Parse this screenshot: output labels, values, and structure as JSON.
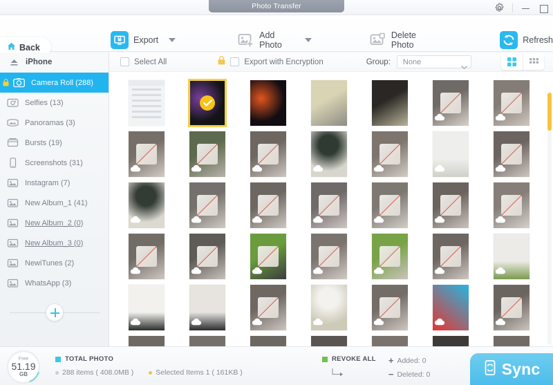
{
  "window": {
    "title": "Photo Transfer",
    "controls": {
      "settings": "gear-icon",
      "minimize": "minimize-icon",
      "maximize": "maximize-icon"
    }
  },
  "toolbar": {
    "back_label": "Back",
    "items": [
      {
        "label": "Export",
        "icon": "export-icon",
        "has_caret": true,
        "accent": true
      },
      {
        "label": "Add Photo",
        "icon": "add-photo-icon",
        "has_caret": true,
        "accent": false
      },
      {
        "label": "Delete Photo",
        "icon": "delete-photo-icon",
        "has_caret": false,
        "accent": false
      },
      {
        "label": "Refresh",
        "icon": "refresh-icon",
        "has_caret": false,
        "accent": true
      }
    ]
  },
  "sidebar": {
    "device": "iPhone",
    "albums": [
      {
        "label": "Camera Roll (288)",
        "active": true,
        "locked": true,
        "underlined": false,
        "icon": "camera-icon"
      },
      {
        "label": "Selfies (13)",
        "active": false,
        "locked": false,
        "underlined": false,
        "icon": "selfie-icon"
      },
      {
        "label": "Panoramas (3)",
        "active": false,
        "locked": false,
        "underlined": false,
        "icon": "panorama-icon"
      },
      {
        "label": "Bursts (19)",
        "active": false,
        "locked": false,
        "underlined": false,
        "icon": "burst-icon"
      },
      {
        "label": "Screenshots (31)",
        "active": false,
        "locked": false,
        "underlined": false,
        "icon": "phone-icon"
      },
      {
        "label": "Instagram (7)",
        "active": false,
        "locked": false,
        "underlined": false,
        "icon": "album-icon"
      },
      {
        "label": "New Album_1 (41)",
        "active": false,
        "locked": false,
        "underlined": false,
        "icon": "album-icon"
      },
      {
        "label": "New Album_2 (0)",
        "active": false,
        "locked": false,
        "underlined": true,
        "icon": "album-icon"
      },
      {
        "label": "New Album_3 (0)",
        "active": false,
        "locked": false,
        "underlined": true,
        "icon": "album-icon"
      },
      {
        "label": "NewiTunes (2)",
        "active": false,
        "locked": false,
        "underlined": false,
        "icon": "album-icon"
      },
      {
        "label": "WhatsApp (3)",
        "active": false,
        "locked": false,
        "underlined": false,
        "icon": "album-icon"
      }
    ],
    "add_album": "add-album-button"
  },
  "content_header": {
    "select_all_label": "Select All",
    "select_all_checked": false,
    "encryption_label": "Export with Encryption",
    "encryption_checked": false,
    "encryption_icon": "lock-icon",
    "group_label": "Group:",
    "group_value": "None",
    "group_options": [
      "None"
    ],
    "view_modes": [
      {
        "name": "large-grid-view",
        "active": true
      },
      {
        "name": "small-grid-view",
        "active": false
      }
    ]
  },
  "grid": {
    "scroll_position": "top",
    "photos": [
      {
        "cloud": false,
        "selected": false,
        "c1": "#f2f3f5",
        "c2": "#e4e6ea",
        "kind": "screenshot"
      },
      {
        "cloud": false,
        "selected": true,
        "c1": "#7a3f9d",
        "c2": "#141418",
        "kind": "wallpaper"
      },
      {
        "cloud": false,
        "selected": false,
        "c1": "#e2541f",
        "c2": "#120d12",
        "kind": "wallpaper"
      },
      {
        "cloud": false,
        "selected": false,
        "c1": "#d8d4b4",
        "c2": "#8e8c84",
        "kind": "glass"
      },
      {
        "cloud": false,
        "selected": false,
        "c1": "#2a2724",
        "c2": "#b9b49a",
        "kind": "glass"
      },
      {
        "cloud": true,
        "selected": false,
        "c1": "#6f6a66",
        "c2": "#d9d2cc",
        "kind": "hand"
      },
      {
        "cloud": true,
        "selected": false,
        "c1": "#847d76",
        "c2": "#cfc7bf",
        "kind": "hand"
      },
      {
        "cloud": true,
        "selected": false,
        "c1": "#766f69",
        "c2": "#d2cbc4",
        "kind": "hand"
      },
      {
        "cloud": true,
        "selected": false,
        "c1": "#5d6a4e",
        "c2": "#b8b2aa",
        "kind": "hand"
      },
      {
        "cloud": true,
        "selected": false,
        "c1": "#6e6761",
        "c2": "#cdc6c0",
        "kind": "hand"
      },
      {
        "cloud": true,
        "selected": false,
        "c1": "#2f3a33",
        "c2": "#d8d6cc",
        "kind": "stand"
      },
      {
        "cloud": true,
        "selected": false,
        "c1": "#7d756e",
        "c2": "#d3ccc6",
        "kind": "hand"
      },
      {
        "cloud": true,
        "selected": false,
        "c1": "#eeeeec",
        "c2": "#cfd1c8",
        "kind": "monitor"
      },
      {
        "cloud": true,
        "selected": false,
        "c1": "#6b6460",
        "c2": "#cec7c1",
        "kind": "hand"
      },
      {
        "cloud": true,
        "selected": false,
        "c1": "#323b34",
        "c2": "#dcd9d0",
        "kind": "stand"
      },
      {
        "cloud": true,
        "selected": false,
        "c1": "#74706b",
        "c2": "#d0cac4",
        "kind": "hand"
      },
      {
        "cloud": true,
        "selected": false,
        "c1": "#6d6762",
        "c2": "#cfc8c2",
        "kind": "hand"
      },
      {
        "cloud": true,
        "selected": false,
        "c1": "#70696a",
        "c2": "#cec6c4",
        "kind": "hand"
      },
      {
        "cloud": true,
        "selected": false,
        "c1": "#7e7872",
        "c2": "#d4cec8",
        "kind": "hand"
      },
      {
        "cloud": true,
        "selected": false,
        "c1": "#6a635e",
        "c2": "#cbc3bd",
        "kind": "hand"
      },
      {
        "cloud": true,
        "selected": false,
        "c1": "#867f79",
        "c2": "#d6d0ca",
        "kind": "hand"
      },
      {
        "cloud": true,
        "selected": false,
        "c1": "#726c67",
        "c2": "#cdc6c1",
        "kind": "hand"
      },
      {
        "cloud": true,
        "selected": false,
        "c1": "#5f5b57",
        "c2": "#c8c1bb",
        "kind": "hand"
      },
      {
        "cloud": true,
        "selected": false,
        "c1": "#6a9c3d",
        "c2": "#3b3b3f",
        "kind": "hand"
      },
      {
        "cloud": true,
        "selected": false,
        "c1": "#7b746e",
        "c2": "#d2cbc5",
        "kind": "hand"
      },
      {
        "cloud": true,
        "selected": false,
        "c1": "#78a347",
        "c2": "#cac3bd",
        "kind": "hand"
      },
      {
        "cloud": true,
        "selected": false,
        "c1": "#6d6661",
        "c2": "#cec7c1",
        "kind": "hand"
      },
      {
        "cloud": true,
        "selected": false,
        "c1": "#ecebe7",
        "c2": "#7b9a4e",
        "kind": "monitor"
      },
      {
        "cloud": true,
        "selected": false,
        "c1": "#f2f1ed",
        "c2": "#2b2f2c",
        "kind": "monitor"
      },
      {
        "cloud": true,
        "selected": false,
        "c1": "#e7e4e0",
        "c2": "#2a2c2e",
        "kind": "monitor"
      },
      {
        "cloud": true,
        "selected": false,
        "c1": "#6f6862",
        "c2": "#cdc5bf",
        "kind": "hand"
      },
      {
        "cloud": true,
        "selected": false,
        "c1": "#f3f2ee",
        "c2": "#cdcab8",
        "kind": "stand"
      },
      {
        "cloud": true,
        "selected": false,
        "c1": "#746d67",
        "c2": "#cfc8c2",
        "kind": "hand"
      },
      {
        "cloud": true,
        "selected": false,
        "c1": "#e8342f",
        "c2": "#24b6e0",
        "kind": "phone"
      },
      {
        "cloud": true,
        "selected": false,
        "c1": "#6b6560",
        "c2": "#ccc5bf",
        "kind": "hand"
      },
      {
        "cloud": false,
        "selected": false,
        "c1": "#6f6963",
        "c2": "#cac3bd",
        "kind": "hand"
      },
      {
        "cloud": false,
        "selected": false,
        "c1": "#75706a",
        "c2": "#cec7c1",
        "kind": "hand"
      },
      {
        "cloud": false,
        "selected": false,
        "c1": "#6d6762",
        "c2": "#cbc4be",
        "kind": "hand"
      },
      {
        "cloud": false,
        "selected": false,
        "c1": "#5b5552",
        "c2": "#c3bcb6",
        "kind": "hand"
      },
      {
        "cloud": false,
        "selected": false,
        "c1": "#7a736d",
        "c2": "#d0c9c3",
        "kind": "hand"
      },
      {
        "cloud": false,
        "selected": false,
        "c1": "#3e3a37",
        "c2": "#b8b1ab",
        "kind": "hand"
      },
      {
        "cloud": false,
        "selected": false,
        "c1": "#726b65",
        "c2": "#cdc6c0",
        "kind": "hand"
      }
    ]
  },
  "status": {
    "disk": {
      "free_label": "Free",
      "value": "51.19",
      "unit": "GB"
    },
    "total_photo": {
      "title": "TOTAL PHOTO",
      "marker_color": "#3ec5ea",
      "items_text": "288 items ( 408.0MB )",
      "selected_text": "Selected Items 1 ( 161KB )",
      "items_dot": "#c9ced4",
      "selected_dot": "#f3c53c"
    },
    "revoke": {
      "title": "REVOKE ALL",
      "marker_color": "#6cc24a",
      "added_text": "Added: 0",
      "deleted_text": "Deleted: 0"
    },
    "sync_label": "Sync"
  }
}
